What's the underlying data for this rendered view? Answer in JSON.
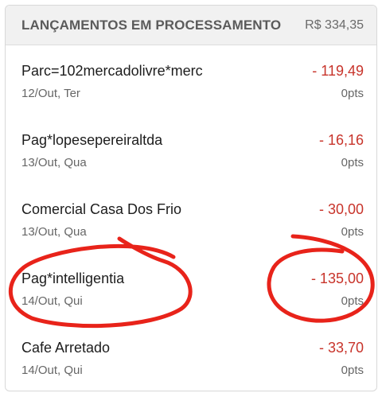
{
  "header": {
    "title": "LANÇAMENTOS EM PROCESSAMENTO",
    "total": "R$ 334,35"
  },
  "transactions": [
    {
      "description": "Parc=102mercadolivre*merc",
      "date": "12/Out, Ter",
      "amount": "- 119,49",
      "points": "0pts"
    },
    {
      "description": "Pag*lopesepereiraltda",
      "date": "13/Out, Qua",
      "amount": "- 16,16",
      "points": "0pts"
    },
    {
      "description": "Comercial Casa Dos Frio",
      "date": "13/Out, Qua",
      "amount": "- 30,00",
      "points": "0pts"
    },
    {
      "description": "Pag*intelligentia",
      "date": "14/Out, Qui",
      "amount": "- 135,00",
      "points": "0pts"
    },
    {
      "description": "Cafe Arretado",
      "date": "14/Out, Qui",
      "amount": "- 33,70",
      "points": "0pts"
    }
  ],
  "colors": {
    "amount": "#c8342b",
    "annotation": "#e8231a",
    "header_bg": "#f1f1f1"
  }
}
